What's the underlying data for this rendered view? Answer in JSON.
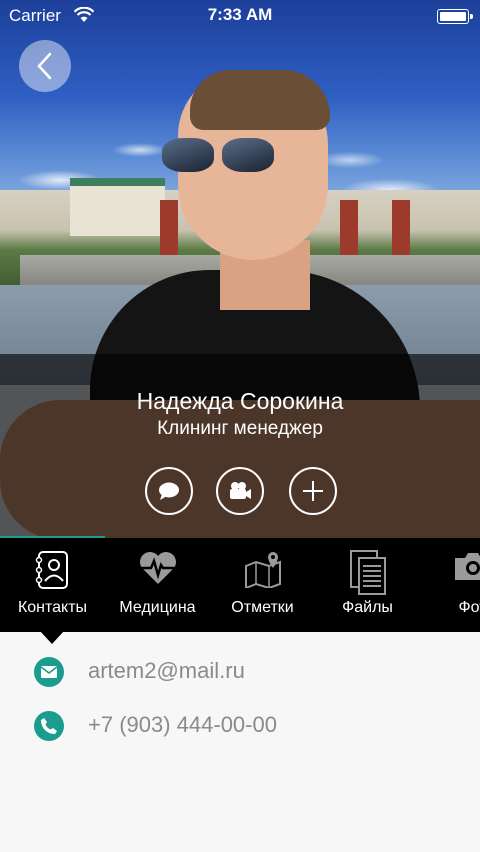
{
  "status_bar": {
    "carrier": "Carrier",
    "time": "7:33 AM"
  },
  "profile": {
    "name": "Надежда Сорокина",
    "role": "Клининг менеджер"
  },
  "actions": [
    "message-icon",
    "video-call-icon",
    "add-icon"
  ],
  "tabs": [
    {
      "label": "Контакты",
      "icon": "contacts-icon",
      "active": true
    },
    {
      "label": "Медицина",
      "icon": "heart-pulse-icon",
      "active": false
    },
    {
      "label": "Отметки",
      "icon": "map-pin-icon",
      "active": false
    },
    {
      "label": "Файлы",
      "icon": "files-icon",
      "active": false
    },
    {
      "label": "Фот",
      "icon": "camera-icon",
      "active": false
    }
  ],
  "contacts": {
    "email": "artem2@mail.ru",
    "phone": "+7 (903) 444-00-00"
  },
  "colors": {
    "accent": "#1a9c8e",
    "tab_bar_bg": "#000000",
    "content_bg": "#f7f7f7",
    "text_secondary": "#8a8a8a"
  }
}
